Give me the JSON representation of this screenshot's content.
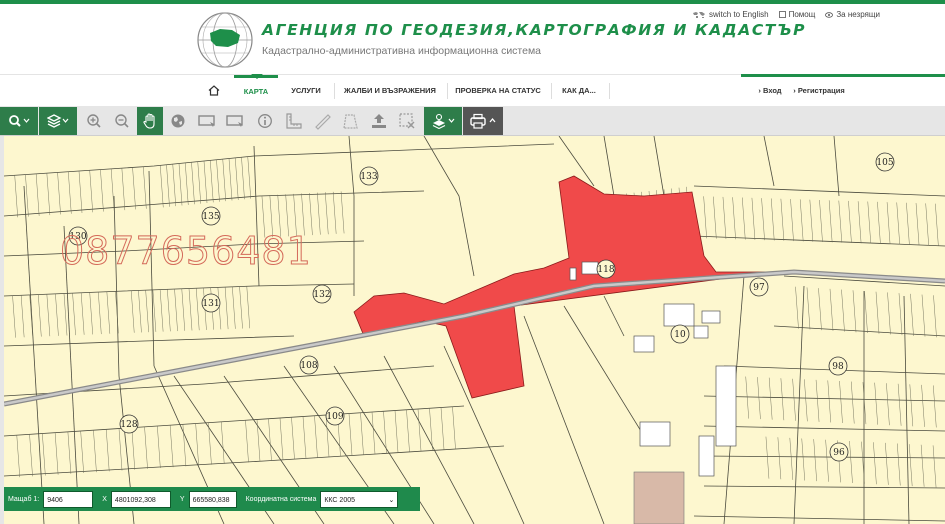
{
  "header": {
    "agency_title": "АГЕНЦИЯ ПО ГЕОДЕЗИЯ,КАРТОГРАФИЯ И КАДАСТЪР",
    "agency_subtitle": "Кадастрално-административна информационна система",
    "top_links": {
      "english": "switch to English",
      "help": "Помощ",
      "accessibility": "За незрящи"
    }
  },
  "nav": {
    "items": [
      {
        "label": "КАРТА",
        "active": true
      },
      {
        "label": "УСЛУГИ"
      },
      {
        "label": "ЖАЛБИ И ВЪЗРАЖЕНИЯ"
      },
      {
        "label": "ПРОВЕРКА НА СТАТУС"
      },
      {
        "label": "КАК ДА..."
      }
    ],
    "login": "Вход",
    "register": "Регистрация"
  },
  "toolbar": {
    "tools": [
      "search-icon",
      "layers-icon",
      "zoom-in-icon",
      "zoom-out-icon",
      "pan-hand-icon",
      "globe-icon",
      "select-rect-icon",
      "select-rect-2-icon",
      "info-icon",
      "measure-ruler-icon",
      "measure-line-icon",
      "measure-area-icon",
      "upload-icon",
      "clear-selection-icon",
      "base-layers-icon",
      "print-icon"
    ]
  },
  "map": {
    "watermark": "0877656481",
    "parcel_labels": [
      "133",
      "105",
      "130",
      "135",
      "118",
      "97",
      "131",
      "132",
      "10",
      "108",
      "98",
      "128",
      "109",
      "96"
    ],
    "colors": {
      "highlight": "#f04a4a",
      "background": "#fdf7cf",
      "road": "#b8b8b8"
    }
  },
  "status_bar": {
    "scale_label": "Мащаб 1:",
    "scale_value": "9406",
    "x_label": "X",
    "x_value": "4801092,308",
    "y_label": "Y",
    "y_value": "665580,838",
    "crs_label": "Координатна система",
    "crs_value": "ККС 2005"
  }
}
